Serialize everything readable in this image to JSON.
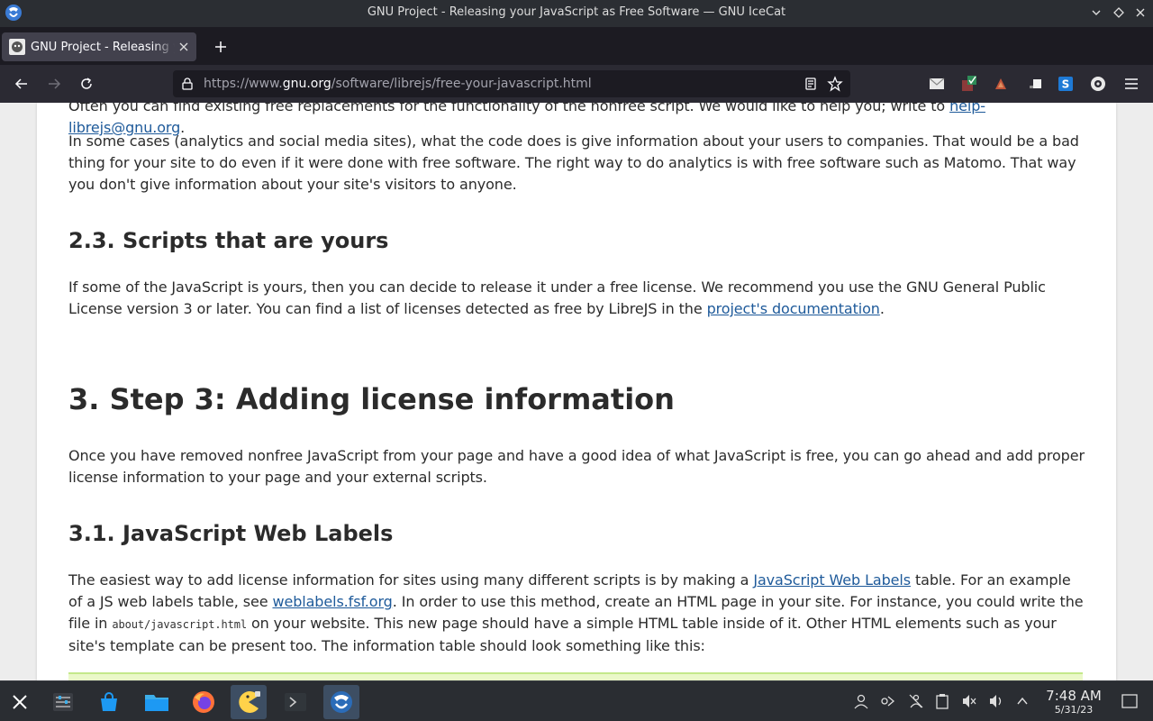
{
  "window": {
    "title": "GNU Project - Releasing your JavaScript as Free Software — GNU IceCat"
  },
  "tab": {
    "label": "GNU Project - Releasing your JavaScript as Free Software"
  },
  "urlbar": {
    "prefix": "https://www.",
    "host": "gnu.org",
    "path": "/software/librejs/free-your-javascript.html"
  },
  "content": {
    "p0_text": "Often you can find existing free replacements for the functionality of the nonfree script. We would like to help you; write to ",
    "p0_link": "help-librejs@gnu.org",
    "p0_end": ".",
    "p1": "In some cases (analytics and social media sites), what the code does is give information about your users to companies. That would be a bad thing for your site to do even if it were done with free software. The right way to do analytics is with free software such as Matomo. That way you don't give information about your site's visitors to anyone.",
    "h_2_3": "2.3. Scripts that are yours",
    "p2_text": "If some of the JavaScript is yours, then you can decide to release it under a free license. We recommend you use the GNU General Public License version 3 or later. You can find a list of licenses detected as free by LibreJS in the ",
    "p2_link": "project's documentation",
    "p2_end": ".",
    "h_3": "3. Step 3: Adding license information",
    "p3": "Once you have removed nonfree JavaScript from your page and have a good idea of what JavaScript is free, you can go ahead and add proper license information to your page and your external scripts.",
    "h_3_1": "3.1. JavaScript Web Labels",
    "p4_a": "The easiest way to add license information for sites using many different scripts is by making a ",
    "p4_link1": "JavaScript Web Labels",
    "p4_b": " table. For an example of a JS web labels table, see ",
    "p4_link2": "weblabels.fsf.org",
    "p4_c": ". In order to use this method, create an HTML page in your site. For instance, you could write the file in ",
    "p4_code": "about/javascript.html",
    "p4_d": " on your website. This new page should have a simple HTML table inside of it. Other HTML elements such as your site's template can be present too. The information table should look something like this:"
  },
  "taskbar": {
    "time": "7:48 AM",
    "date": "5/31/23"
  },
  "colors": {
    "link": "#1e5a9a",
    "code_block_bg": "#eaf8c8"
  },
  "icons": [
    "app-launcher-icon",
    "system-settings-icon",
    "discover-store-icon",
    "file-manager-icon",
    "firefox-icon",
    "pacman-game-icon",
    "terminal-icon",
    "icecat-icon"
  ]
}
